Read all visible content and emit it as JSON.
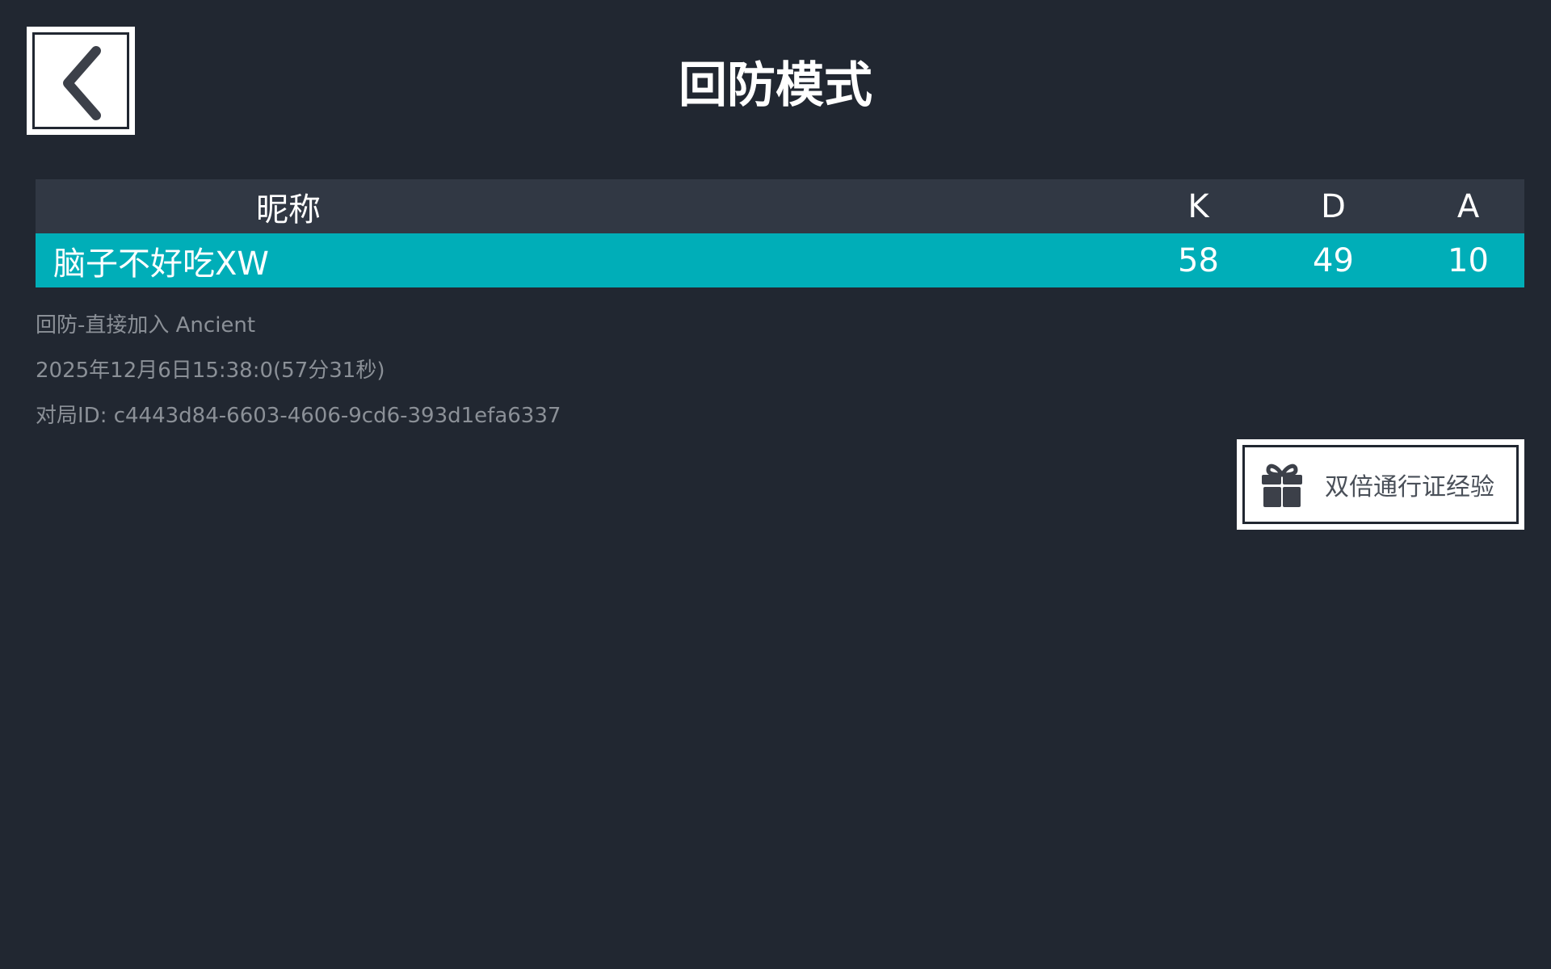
{
  "header": {
    "title": "回防模式",
    "back_icon": "chevron-left-icon"
  },
  "table": {
    "columns": [
      "昵称",
      "K",
      "D",
      "A"
    ],
    "rows": [
      {
        "name": "脑子不好吃XW",
        "k": "58",
        "d": "49",
        "a": "10"
      }
    ]
  },
  "match_info": {
    "mode_map": "回防-直接加入 Ancient",
    "datetime": "2025年12月6日15:38:0(57分31秒)",
    "match_id": "对局ID: c4443d84-6603-4606-9cd6-393d1efa6337"
  },
  "double_xp": {
    "label": "双倍通行证经验",
    "icon": "gift-icon"
  },
  "colors": {
    "background": "#212731",
    "header_row": "#313844",
    "highlight_row": "#00aeb8",
    "muted_text": "#8b9097"
  }
}
